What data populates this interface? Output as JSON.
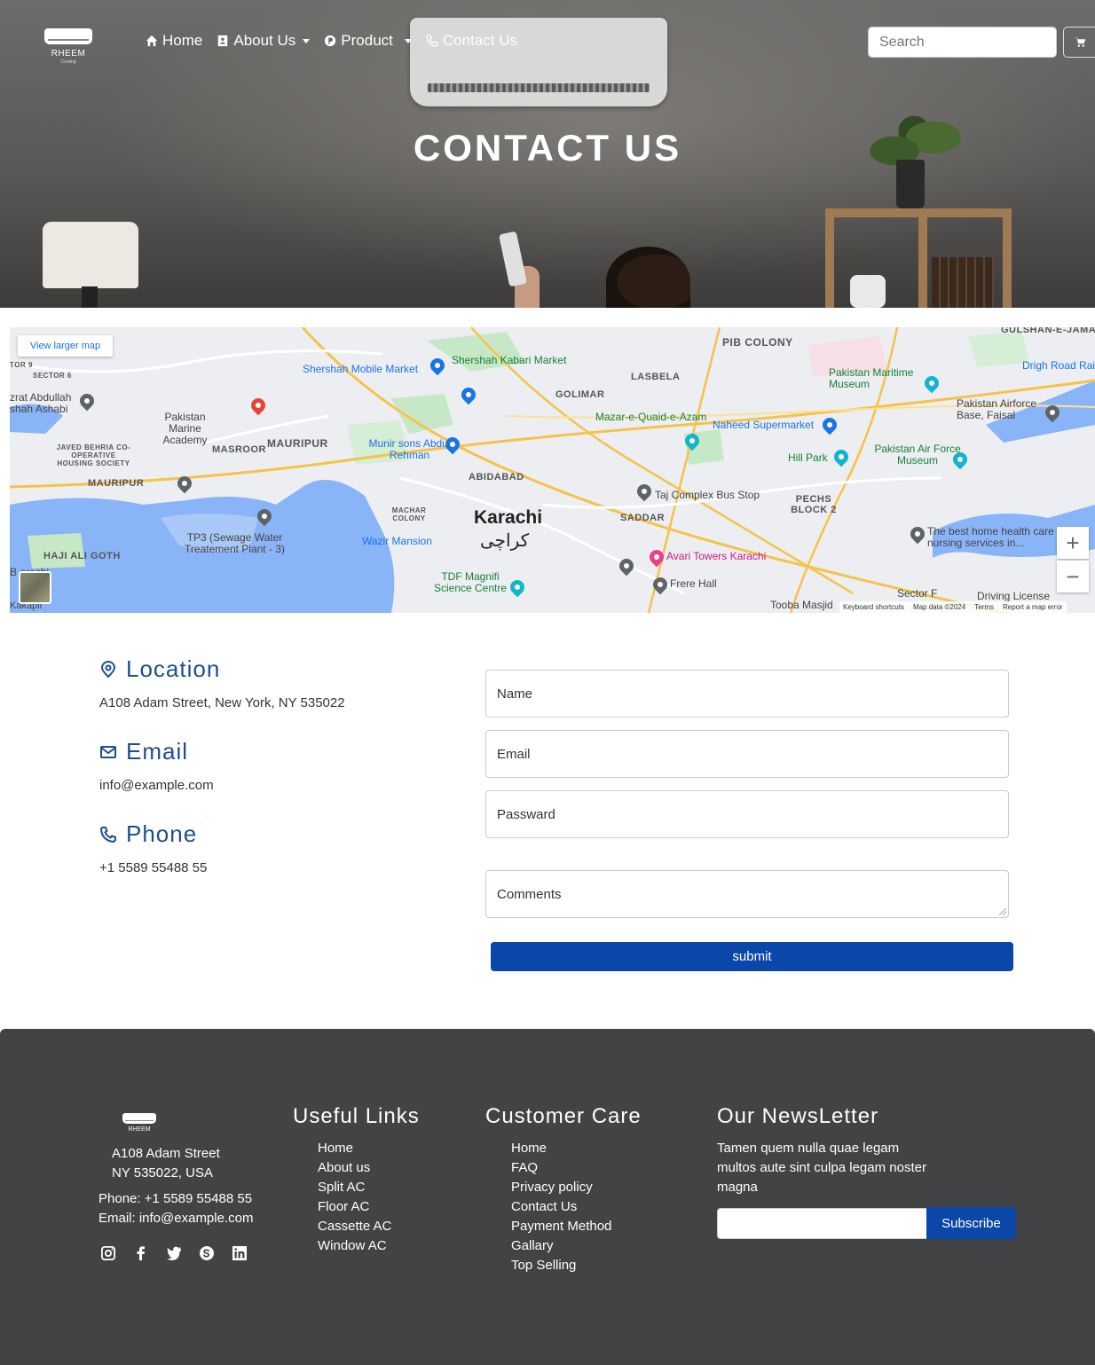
{
  "brand": {
    "name": "RHEEM",
    "tagline": "Cooling"
  },
  "nav": {
    "items": [
      {
        "label": "Home",
        "icon": "home-icon",
        "dropdown": false
      },
      {
        "label": "About Us",
        "icon": "id-card-icon",
        "dropdown": true
      },
      {
        "label": "Product",
        "icon": "product-icon",
        "dropdown": true
      },
      {
        "label": "Contact Us",
        "icon": "phone-icon",
        "dropdown": false
      }
    ],
    "search_placeholder": "Search",
    "cart_icon": "cart-icon"
  },
  "hero": {
    "title": "CONTACT US"
  },
  "map": {
    "view_larger": "View larger map",
    "city": "Karachi",
    "city_urdu": "کراچی",
    "labels": {
      "pib": "PIB COLONY",
      "gulshan": "GULSHAN-E-JAMA",
      "drigh": "Drigh Road Rail",
      "shershah_market": "Shershah Mobile Market",
      "kabari": "Shershah Kabari Market",
      "golimar": "GOLIMAR",
      "lasbela": "LASBELA",
      "maritime": "Pakistan Maritime Museum",
      "airforce": "Pakistan Airforce Base, Faisal",
      "mazar": "Mazar-e-Quaid-e-Azam",
      "naheed": "Naheed Supermarket",
      "marine": "Pakistan Marine Academy",
      "masroor": "MASROOR",
      "mauripur": "MAURIPUR",
      "munir": "Munir sons Abdul Rehman",
      "hill_park": "Hill Park",
      "air_force_museum": "Pakistan Air Force Museum",
      "abidabad": "ABIDABAD",
      "taj": "Taj Complex Bus Stop",
      "pechs": "PECHS BLOCK 2",
      "mauripur2": "MAURIPUR",
      "javed": "JAVED BEHRIA CO-OPERATIVE HOUSING SOCIETY",
      "machar": "MACHAR COLONY",
      "saddar": "SADDAR",
      "tp3": "TP3 (Sewage Water Treatement Plant - 3)",
      "wazir": "Wazir Mansion",
      "avari": "Avari Towers Karachi",
      "homehealth": "The best home health care nursing services in...",
      "haji": "HAJI ALI GOTH",
      "tdf": "TDF Magnifi Science Centre",
      "frere": "Frere Hall",
      "sector": "Sector F",
      "driving": "Driving License",
      "tooba": "Tooba Masjid",
      "abdullah": "zrat Abdullah shah Ashabi",
      "sector6": "SECTOR 6",
      "tor9": "TOR 9",
      "kakapir": "Kakapir",
      "barachi": "B    arachi"
    },
    "footer": [
      "Keyboard shortcuts",
      "Map data ©2024",
      "Terms",
      "Report a map error"
    ],
    "zoom_in": "+",
    "zoom_out": "−"
  },
  "contact": {
    "location": {
      "title": "Location",
      "text": "A108 Adam Street, New York, NY 535022",
      "icon": "map-pin-icon"
    },
    "email": {
      "title": "Email",
      "text": "info@example.com",
      "icon": "envelope-icon"
    },
    "phone": {
      "title": "Phone",
      "text": "+1 5589 55488 55",
      "icon": "phone-icon"
    }
  },
  "form": {
    "name_placeholder": "Name",
    "email_placeholder": "Email",
    "password_placeholder": "Passward",
    "comments_placeholder": "Comments",
    "submit_label": "submit"
  },
  "footer": {
    "address_line1": "A108 Adam Street",
    "address_line2": "NY 535022, USA",
    "phone_line": "Phone: +1 5589 55488 55",
    "email_line": "Email: info@example.com",
    "useful_links": {
      "title": "Useful Links",
      "items": [
        "Home",
        "About us",
        "Split AC",
        "Floor AC",
        "Cassette AC",
        "Window AC"
      ]
    },
    "customer_care": {
      "title": "Customer Care",
      "items": [
        "Home",
        "FAQ",
        "Privacy policy",
        "Contact Us",
        "Payment Method",
        "Gallary",
        "Top Selling"
      ]
    },
    "newsletter": {
      "title": "Our NewsLetter",
      "text_line1": "Tamen quem nulla quae legam",
      "text_line2": "multos aute sint culpa legam noster",
      "text_line3": "magna",
      "button": "Subscribe"
    },
    "social": [
      "instagram-icon",
      "facebook-icon",
      "twitter-icon",
      "skype-icon",
      "linkedin-icon"
    ]
  }
}
